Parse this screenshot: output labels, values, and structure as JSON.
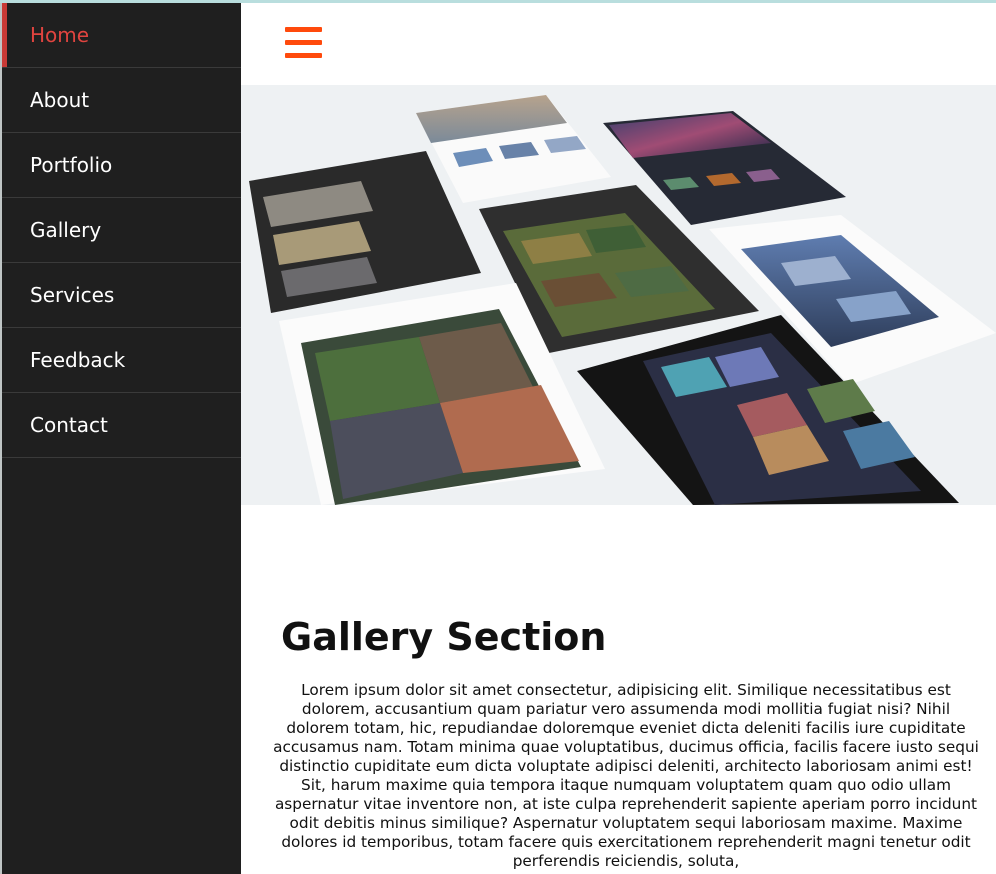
{
  "sidebar": {
    "items": [
      {
        "label": "Home"
      },
      {
        "label": "About"
      },
      {
        "label": "Portfolio"
      },
      {
        "label": "Gallery"
      },
      {
        "label": "Services"
      },
      {
        "label": "Feedback"
      },
      {
        "label": "Contact"
      }
    ]
  },
  "header": {
    "menu_icon": "hamburger-menu-icon",
    "accent_color": "#ff4a0c"
  },
  "hero": {
    "image_name": "website-templates-collage"
  },
  "gallery": {
    "title": "Gallery Section",
    "body": "Lorem ipsum dolor sit amet consectetur, adipisicing elit. Similique necessitatibus est dolorem, accusantium quam pariatur vero assumenda modi mollitia fugiat nisi? Nihil dolorem totam, hic, repudiandae doloremque eveniet dicta deleniti facilis iure cupiditate accusamus nam. Totam minima quae voluptatibus, ducimus officia, facilis facere iusto sequi distinctio cupiditate eum dicta voluptate adipisci deleniti, architecto laboriosam animi est! Sit, harum maxime quia tempora itaque numquam voluptatem quam quo odio ullam aspernatur vitae inventore non, at iste culpa reprehenderit sapiente aperiam porro incidunt odit debitis minus similique? Aspernatur voluptatem sequi laboriosam maxime. Maxime dolores id temporibus, totam facere quis exercitationem reprehenderit magni tenetur odit perferendis reiciendis, soluta,"
  },
  "colors": {
    "sidebar_bg": "#1f1f1f",
    "active_text": "#e0443f"
  }
}
